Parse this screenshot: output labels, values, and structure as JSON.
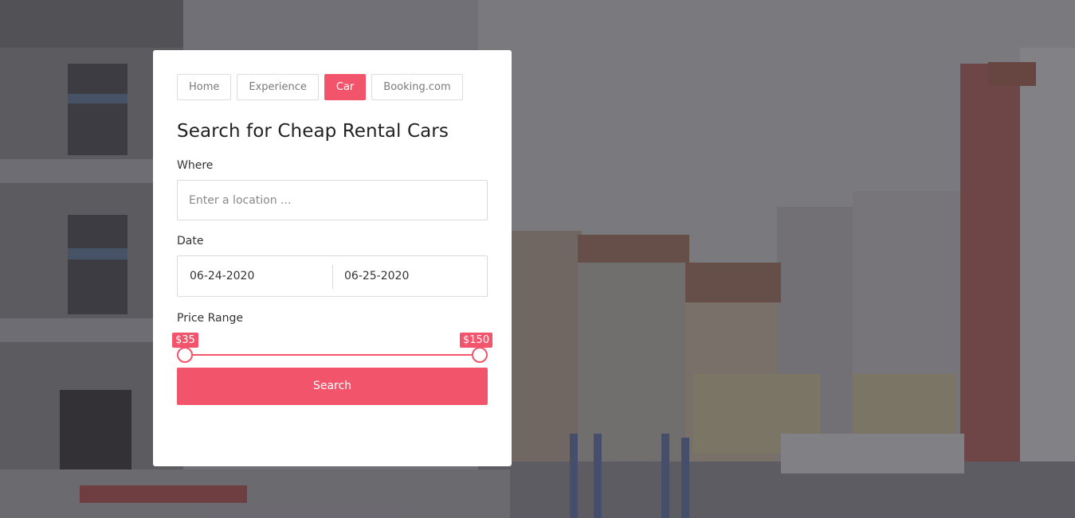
{
  "nav": {
    "tabs": [
      {
        "label": "Home",
        "active": false
      },
      {
        "label": "Experience",
        "active": false
      },
      {
        "label": "Car",
        "active": true
      },
      {
        "label": "Booking.com",
        "active": false
      }
    ]
  },
  "form": {
    "title": "Search for Cheap Rental Cars",
    "where": {
      "label": "Where",
      "placeholder": "Enter a location ..."
    },
    "date": {
      "label": "Date",
      "start": "06-24-2020",
      "end": "06-25-2020"
    },
    "price": {
      "label": "Price Range",
      "min_label": "$35",
      "max_label": "$150",
      "min_fraction": 0.0,
      "max_fraction": 1.0
    },
    "search_label": "Search"
  },
  "colors": {
    "accent": "#f2546b"
  }
}
